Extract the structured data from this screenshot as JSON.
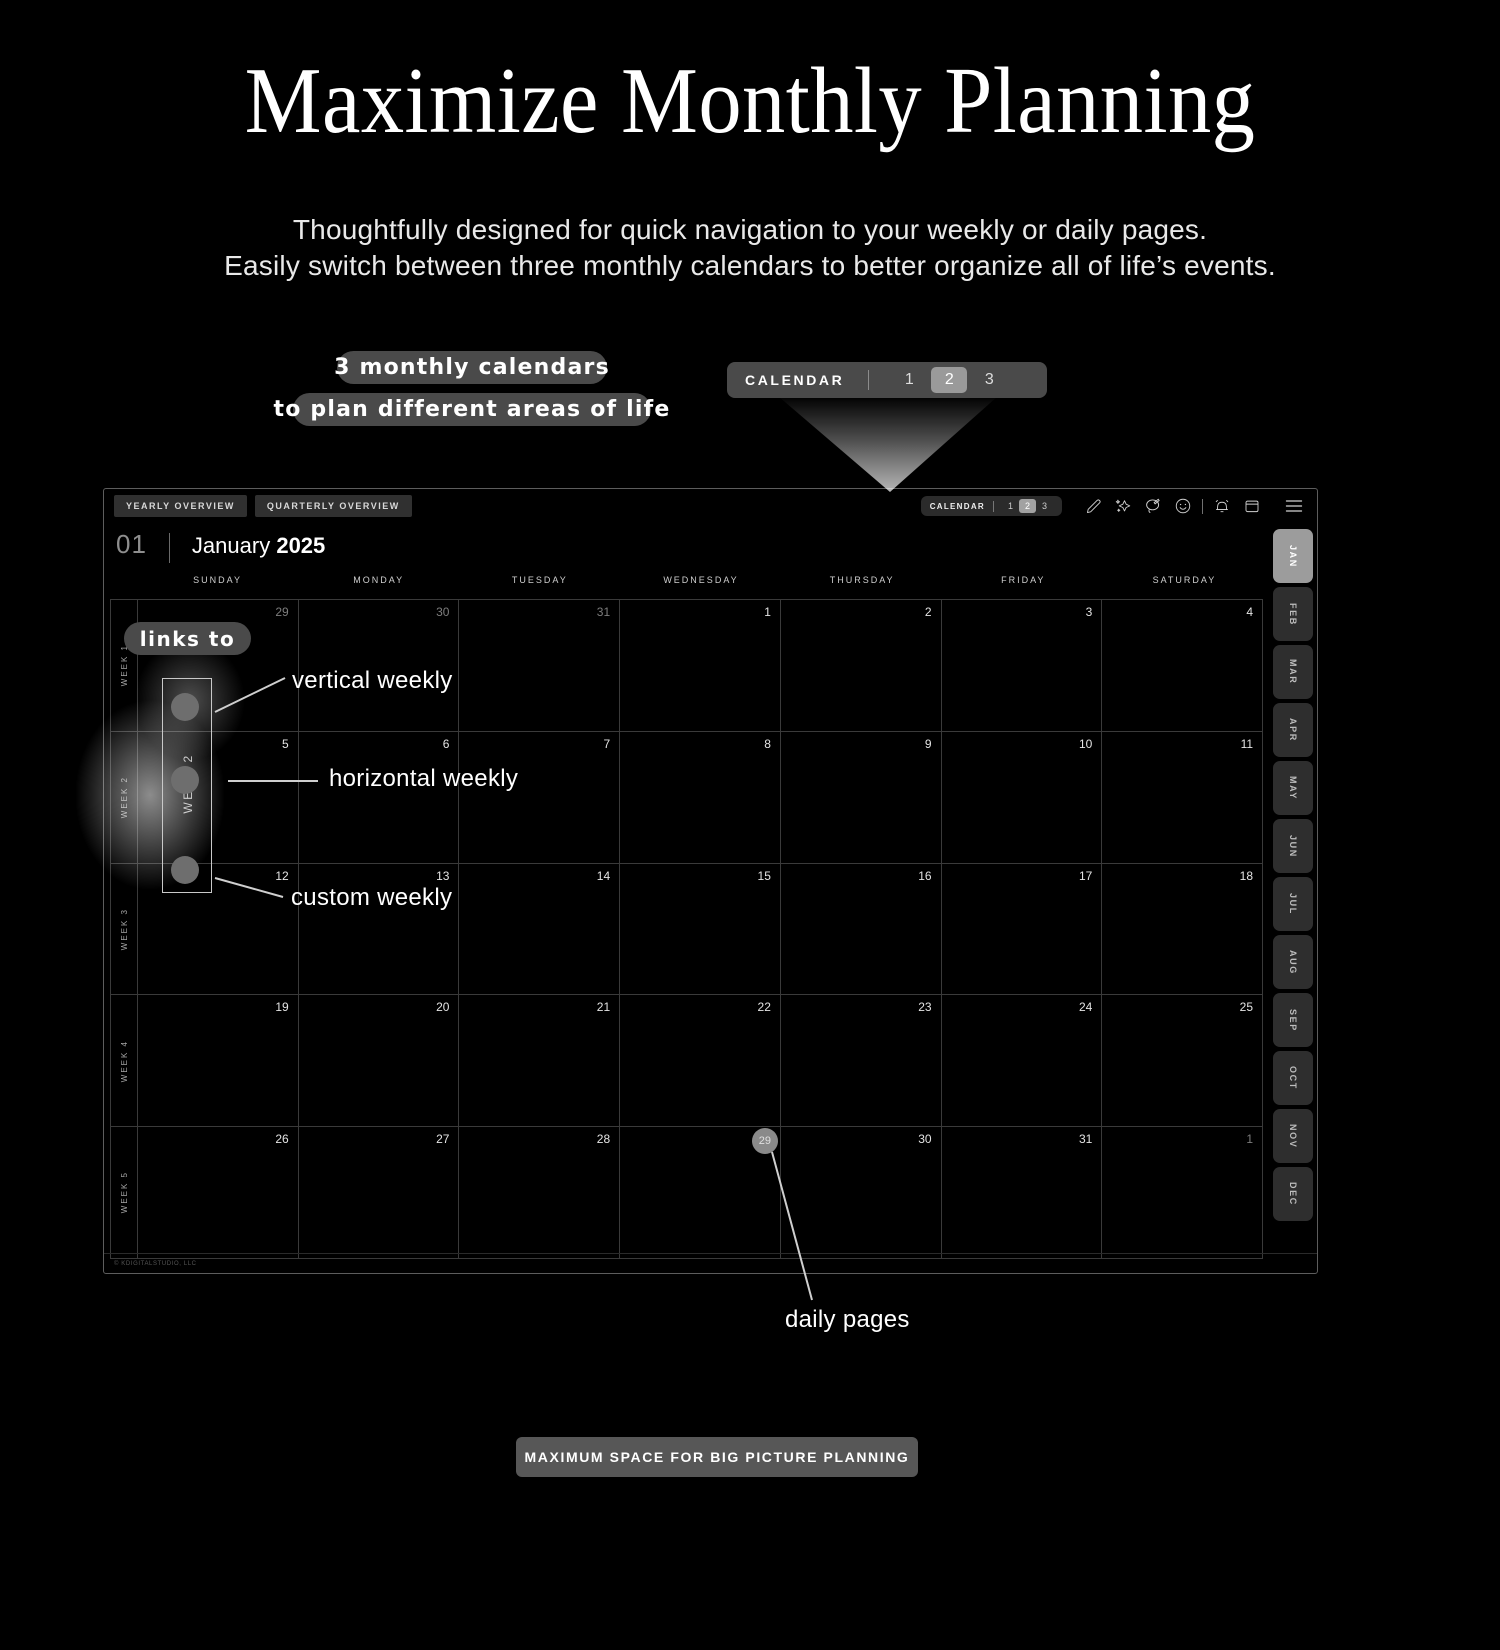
{
  "headline": "Maximize Monthly Planning",
  "subhead": {
    "line1": "Thoughtfully designed for quick navigation to your weekly or daily pages.",
    "line2": "Easily switch between three monthly calendars to better organize all of life’s events."
  },
  "pills": {
    "a": "3 monthly calendars",
    "b": "to plan different areas of life"
  },
  "calendar_selector": {
    "label": "CALENDAR",
    "options": [
      "1",
      "2",
      "3"
    ],
    "active": "2"
  },
  "tablet": {
    "overview_buttons": [
      "YEARLY OVERVIEW",
      "QUARTERLY OVERVIEW"
    ],
    "toolbar_icons": [
      "pen-icon",
      "sparkle-icon",
      "lasso-icon",
      "smiley-icon",
      "bell-icon",
      "calendar-icon",
      "menu-icon"
    ],
    "month_number": "01",
    "month_name": "January",
    "year": "2025",
    "day_headers": [
      "SUNDAY",
      "MONDAY",
      "TUESDAY",
      "WEDNESDAY",
      "THURSDAY",
      "FRIDAY",
      "SATURDAY"
    ],
    "week_labels": [
      "WEEK 1",
      "WEEK 2",
      "WEEK 3",
      "WEEK 4",
      "WEEK 5"
    ],
    "weeks": [
      [
        {
          "n": "29",
          "state": "dim"
        },
        {
          "n": "30",
          "state": "dim"
        },
        {
          "n": "31",
          "state": "dim"
        },
        {
          "n": "1",
          "state": "on"
        },
        {
          "n": "2",
          "state": "on"
        },
        {
          "n": "3",
          "state": "on"
        },
        {
          "n": "4",
          "state": "on"
        }
      ],
      [
        {
          "n": "5",
          "state": "on"
        },
        {
          "n": "6",
          "state": "on"
        },
        {
          "n": "7",
          "state": "on"
        },
        {
          "n": "8",
          "state": "on"
        },
        {
          "n": "9",
          "state": "on"
        },
        {
          "n": "10",
          "state": "on"
        },
        {
          "n": "11",
          "state": "on"
        }
      ],
      [
        {
          "n": "12",
          "state": "on"
        },
        {
          "n": "13",
          "state": "on"
        },
        {
          "n": "14",
          "state": "on"
        },
        {
          "n": "15",
          "state": "on"
        },
        {
          "n": "16",
          "state": "on"
        },
        {
          "n": "17",
          "state": "on"
        },
        {
          "n": "18",
          "state": "on"
        }
      ],
      [
        {
          "n": "19",
          "state": "on"
        },
        {
          "n": "20",
          "state": "on"
        },
        {
          "n": "21",
          "state": "on"
        },
        {
          "n": "22",
          "state": "on"
        },
        {
          "n": "23",
          "state": "on"
        },
        {
          "n": "24",
          "state": "on"
        },
        {
          "n": "25",
          "state": "on"
        }
      ],
      [
        {
          "n": "26",
          "state": "on"
        },
        {
          "n": "27",
          "state": "on"
        },
        {
          "n": "28",
          "state": "on"
        },
        {
          "n": "29",
          "state": "circle"
        },
        {
          "n": "30",
          "state": "on"
        },
        {
          "n": "31",
          "state": "on"
        },
        {
          "n": "1",
          "state": "dim"
        }
      ]
    ],
    "month_tabs": [
      "JAN",
      "FEB",
      "MAR",
      "APR",
      "MAY",
      "JUN",
      "JUL",
      "AUG",
      "SEP",
      "OCT",
      "NOV",
      "DEC"
    ],
    "active_month_tab": "JAN",
    "footer": "© KDIGITALSTUDIO, LLC"
  },
  "annotations": {
    "links_to": "links to",
    "week_box_label": "WEEK 2",
    "vertical_weekly": "vertical weekly",
    "horizontal_weekly": "horizontal weekly",
    "custom_weekly": "custom weekly",
    "daily_pages": "daily pages"
  },
  "cta": "MAXIMUM SPACE FOR BIG PICTURE PLANNING",
  "colors": {
    "background": "#000000",
    "pill": "#4a4a4a",
    "accent_active": "#9a9a9a",
    "grid_line": "#3a3a3a",
    "text": "#ffffff"
  }
}
